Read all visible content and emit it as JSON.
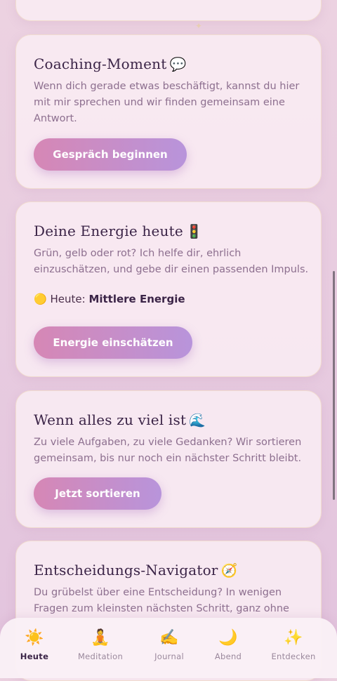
{
  "cards": [
    {
      "title": "Coaching-Moment",
      "emoji": "💬",
      "text": "Wenn dich gerade etwas beschäftigt, kannst du hier mit mir sprechen und wir finden gemeinsam eine Antwort.",
      "button": "Gespräch beginnen"
    },
    {
      "title": "Deine Energie heute",
      "emoji": "🚦",
      "text": "Grün, gelb oder rot? Ich helfe dir, ehrlich einzuschätzen, und gebe dir einen passenden Impuls.",
      "status_emoji": "🟡",
      "status_prefix": "Heute:",
      "status_value": "Mittlere Energie",
      "button": "Energie einschätzen"
    },
    {
      "title": "Wenn alles zu viel ist",
      "emoji": "🌊",
      "text": "Zu viele Aufgaben, zu viele Gedanken? Wir sortieren gemeinsam, bis nur noch ein nächster Schritt bleibt.",
      "button": "Jetzt sortieren"
    },
    {
      "title": "Entscheidungs-Navigator",
      "emoji": "🧭",
      "text": "Du grübelst über eine Entscheidung? In wenigen Fragen zum kleinsten nächsten Schritt, ganz ohne"
    }
  ],
  "tabs": [
    {
      "label": "Heute",
      "icon": "☀️",
      "active": true
    },
    {
      "label": "Meditation",
      "icon": "🧘"
    },
    {
      "label": "Journal",
      "icon": "✍️"
    },
    {
      "label": "Abend",
      "icon": "🌙"
    },
    {
      "label": "Entdecken",
      "icon": "✨"
    }
  ],
  "colors": {
    "button_gradient_start": "#d687b5",
    "button_gradient_end": "#b894db",
    "title": "#3b2447",
    "body_text": "#8d6f8f"
  }
}
